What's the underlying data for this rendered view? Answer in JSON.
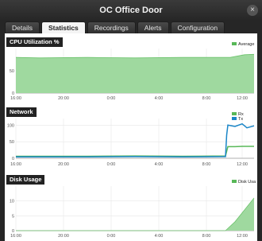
{
  "window": {
    "title": "OC Office Door",
    "close_glyph": "×"
  },
  "tabs": [
    {
      "label": "Details",
      "active": false
    },
    {
      "label": "Statistics",
      "active": true
    },
    {
      "label": "Recordings",
      "active": false
    },
    {
      "label": "Alerts",
      "active": false
    },
    {
      "label": "Configuration",
      "active": false
    }
  ],
  "colors": {
    "fill_green": "#9fd99f",
    "line_green": "#6cc36c",
    "legend_green": "#58b858",
    "blue": "#1a86c8"
  },
  "chart_data": [
    {
      "title": "CPU Utilization %",
      "type": "area",
      "x_ticks": [
        "16:00",
        "20:00",
        "0:00",
        "4:00",
        "8:00",
        "12:00"
      ],
      "y_ticks": [
        "0",
        "50"
      ],
      "ylim": [
        0,
        100
      ],
      "series": [
        {
          "name": "Average",
          "color": "#9fd99f",
          "x": [
            0,
            0.1,
            0.3,
            0.5,
            0.7,
            0.9,
            0.96,
            1.0
          ],
          "values": [
            80,
            79,
            80,
            79,
            80,
            80,
            86,
            87
          ]
        }
      ]
    },
    {
      "title": "Network",
      "type": "line",
      "x_ticks": [
        "16:00",
        "20:00",
        "0:00",
        "4:00",
        "8:00",
        "12:00"
      ],
      "y_ticks": [
        "0",
        "50",
        "100"
      ],
      "ylim": [
        0,
        120
      ],
      "series": [
        {
          "name": "Rx",
          "color": "#58b858",
          "x": [
            0,
            0.1,
            0.3,
            0.5,
            0.7,
            0.88,
            0.89,
            0.92,
            0.95,
            1.0
          ],
          "values": [
            6,
            6,
            6,
            7,
            6,
            7,
            35,
            35,
            36,
            36
          ]
        },
        {
          "name": "Tx",
          "color": "#1a86c8",
          "x": [
            0,
            0.1,
            0.3,
            0.5,
            0.7,
            0.88,
            0.885,
            0.89,
            0.92,
            0.95,
            0.97,
            1.0
          ],
          "values": [
            4,
            4,
            4,
            5,
            4,
            5,
            70,
            100,
            96,
            104,
            92,
            98
          ]
        }
      ]
    },
    {
      "title": "Disk Usage",
      "type": "area",
      "x_ticks": [
        "16:00",
        "20:00",
        "0:00",
        "4:00",
        "8:00",
        "12:00"
      ],
      "y_ticks": [
        "0",
        "5",
        "10"
      ],
      "ylim": [
        0,
        15
      ],
      "series": [
        {
          "name": "Disk Usage",
          "color": "#9fd99f",
          "x": [
            0,
            0.88,
            0.92,
            0.96,
            1.0
          ],
          "values": [
            0,
            0,
            3,
            7,
            11
          ]
        }
      ]
    }
  ]
}
